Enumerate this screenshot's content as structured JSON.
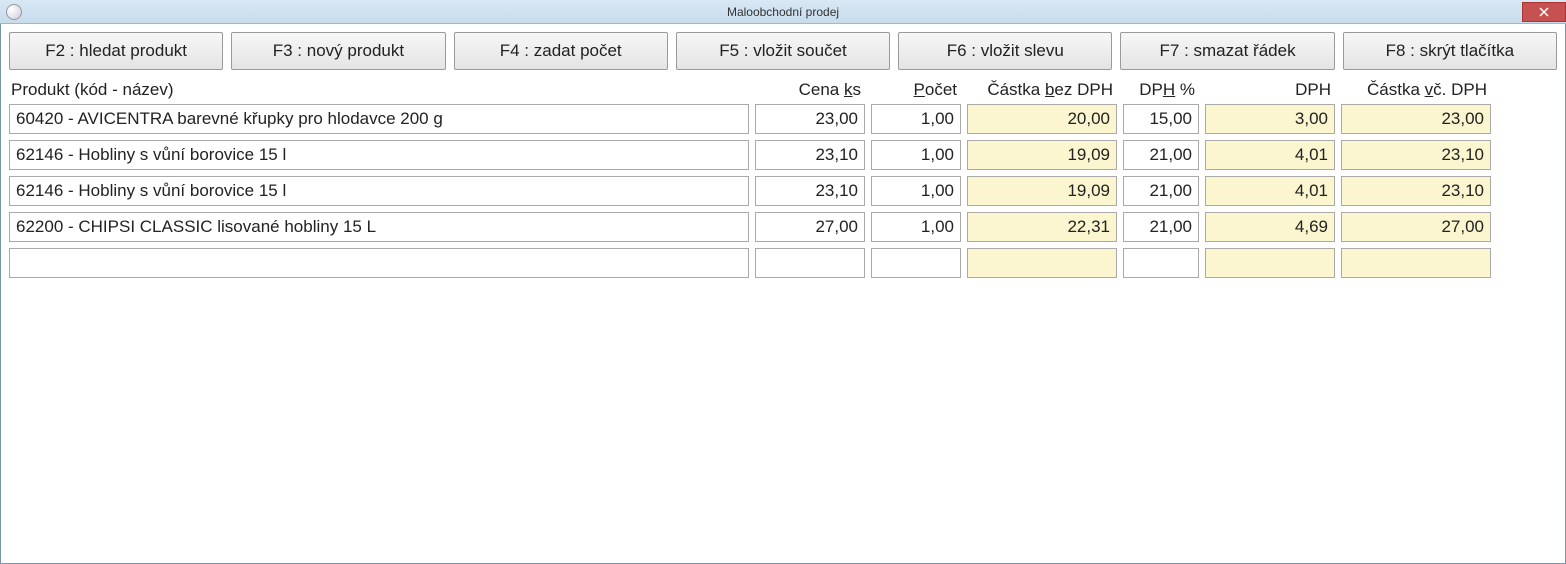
{
  "window": {
    "title": "Maloobchodní prodej"
  },
  "toolbar": {
    "f2": "F2 : hledat produkt",
    "f3": "F3 : nový produkt",
    "f4": "F4 : zadat počet",
    "f5": "F5 : vložit součet",
    "f6": "F6 : vložit slevu",
    "f7": "F7 : smazat řádek",
    "f8": "F8 : skrýt tlačítka"
  },
  "headers": {
    "product_pre": "Produkt (kód - název)",
    "cenaks_pre": "Cena ",
    "cenaks_ul": "k",
    "cenaks_post": "s",
    "pocet_ul": "P",
    "pocet_post": "očet",
    "castkabez_pre": "Částka ",
    "castkabez_ul": "b",
    "castkabez_post": "ez DPH",
    "dphpct_pre": "DP",
    "dphpct_ul": "H",
    "dphpct_post": " %",
    "dph": "DPH",
    "castkavc_pre": "Částka ",
    "castkavc_ul": "v",
    "castkavc_post": "č. DPH"
  },
  "rows": [
    {
      "product": "60420 - AVICENTRA barevné křupky pro hlodavce 200 g",
      "cena": "23,00",
      "pocet": "1,00",
      "bezdph": "20,00",
      "dphpct": "15,00",
      "dph": "3,00",
      "vcdph": "23,00"
    },
    {
      "product": "62146 - Hobliny s vůní borovice 15 l",
      "cena": "23,10",
      "pocet": "1,00",
      "bezdph": "19,09",
      "dphpct": "21,00",
      "dph": "4,01",
      "vcdph": "23,10"
    },
    {
      "product": "62146 - Hobliny s vůní borovice 15 l",
      "cena": "23,10",
      "pocet": "1,00",
      "bezdph": "19,09",
      "dphpct": "21,00",
      "dph": "4,01",
      "vcdph": "23,10"
    },
    {
      "product": "62200 - CHIPSI CLASSIC lisované hobliny 15 L",
      "cena": "27,00",
      "pocet": "1,00",
      "bezdph": "22,31",
      "dphpct": "21,00",
      "dph": "4,69",
      "vcdph": "27,00"
    },
    {
      "product": "",
      "cena": "",
      "pocet": "",
      "bezdph": "",
      "dphpct": "",
      "dph": "",
      "vcdph": ""
    }
  ]
}
